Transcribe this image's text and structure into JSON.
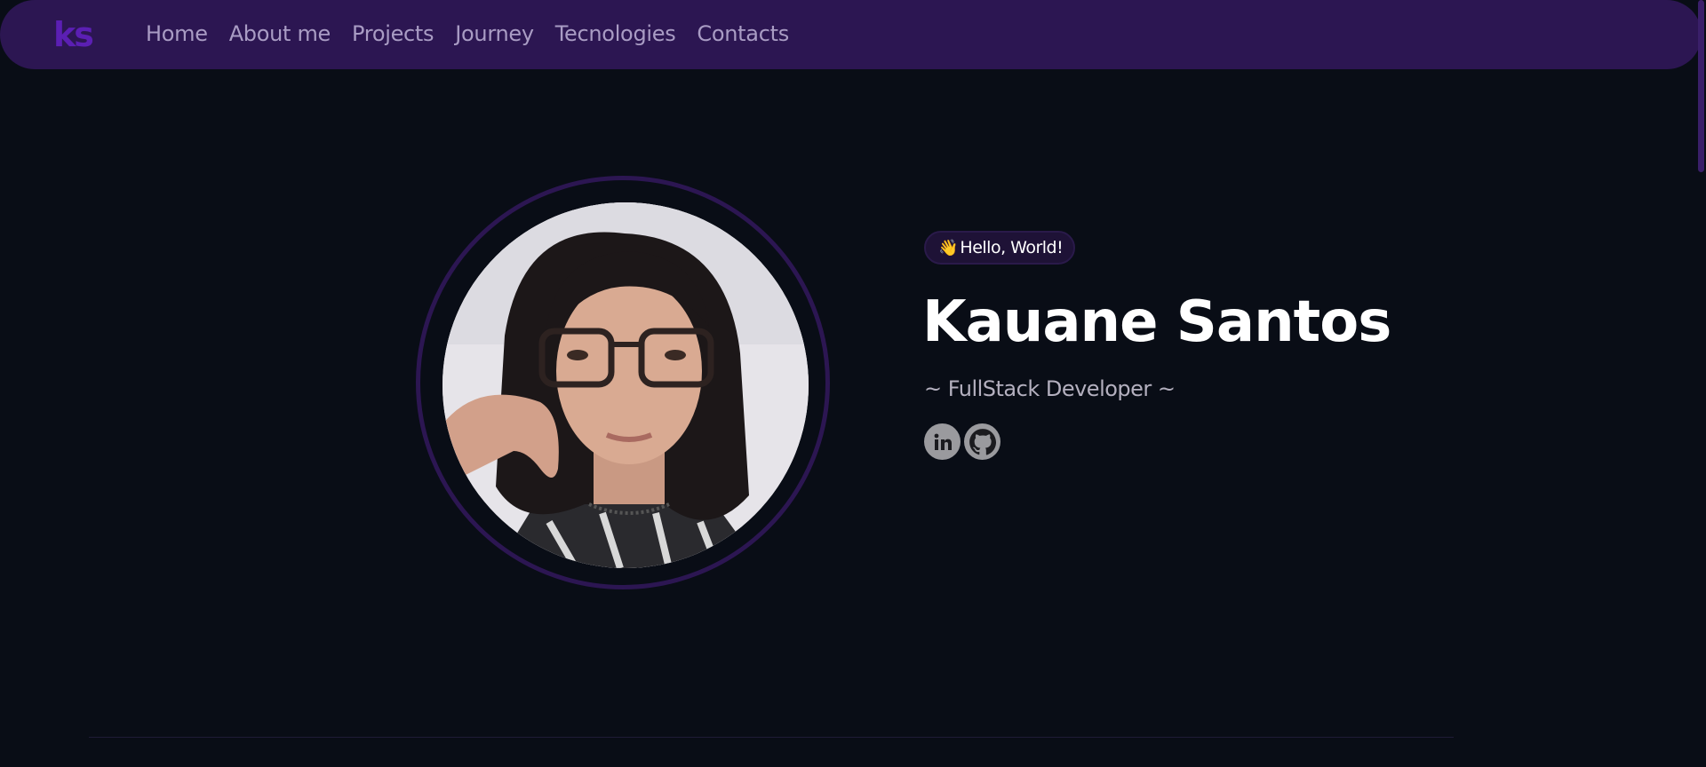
{
  "navbar": {
    "logo": "ks",
    "links": [
      "Home",
      "About me",
      "Projects",
      "Journey",
      "Tecnologies",
      "Contacts"
    ]
  },
  "hero": {
    "greeting_icon": "waving-hand-icon",
    "greeting": "Hello, World!",
    "name": "Kauane Santos",
    "role": "~ FullStack Developer ~",
    "socials": [
      {
        "icon": "linkedin-icon"
      },
      {
        "icon": "github-icon"
      }
    ]
  },
  "colors": {
    "background": "#090d16",
    "navbar": "#2c1652",
    "logo": "#5b1fb3",
    "nav_text": "#a99cc4",
    "ring": "#2c1652",
    "social_icon_bg": "#9a9a9e"
  }
}
